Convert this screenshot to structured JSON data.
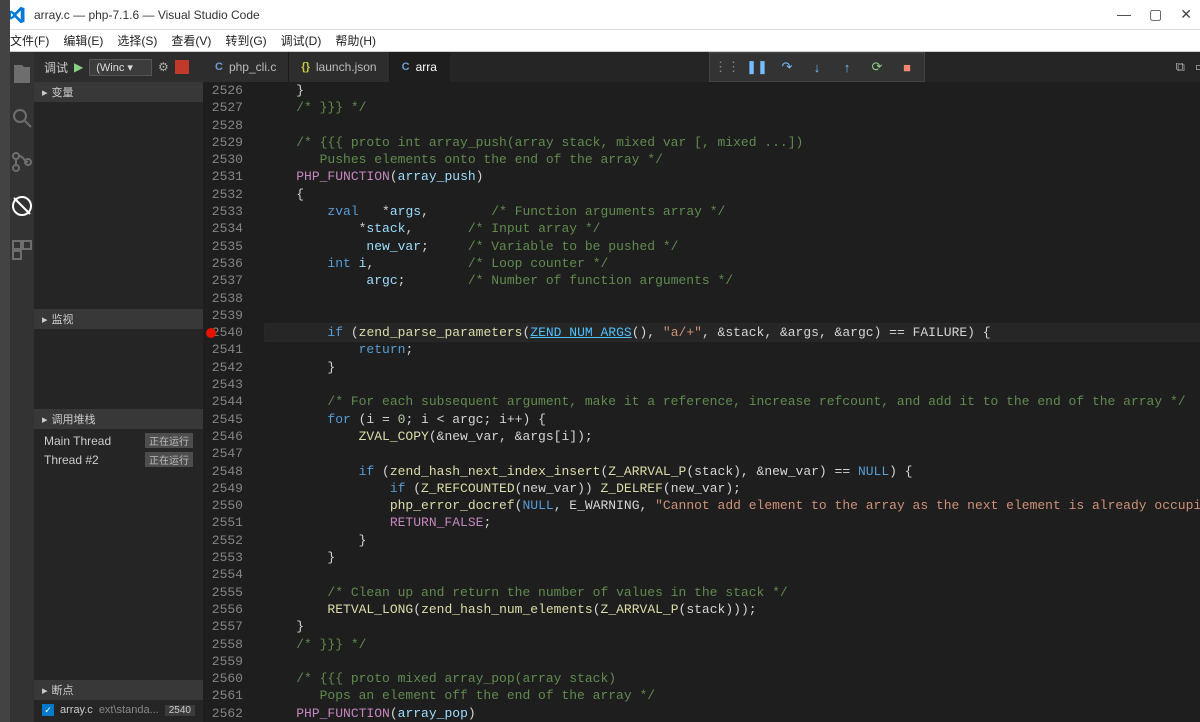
{
  "window": {
    "title": "array.c — php-7.1.6 — Visual Studio Code"
  },
  "menubar": [
    "文件(F)",
    "编辑(E)",
    "选择(S)",
    "查看(V)",
    "转到(G)",
    "调试(D)",
    "帮助(H)"
  ],
  "debugTop": {
    "label": "调试",
    "config": "(Winc"
  },
  "sidebar": {
    "variables": {
      "title": "变量"
    },
    "watch": {
      "title": "监视"
    },
    "callstack": {
      "title": "调用堆栈",
      "threads": [
        {
          "name": "Main Thread",
          "state": "正在运行"
        },
        {
          "name": "Thread #2",
          "state": "正在运行"
        }
      ]
    },
    "breakpoints": {
      "title": "断点",
      "items": [
        {
          "label": "array.c",
          "detail": "ext\\standa...",
          "line": "2540"
        }
      ]
    }
  },
  "tabs": [
    {
      "iconLetter": "C",
      "iconClass": "c-c",
      "label": "php_cli.c",
      "active": false
    },
    {
      "iconLetter": "{}",
      "iconClass": "c-j",
      "label": "launch.json",
      "active": false
    },
    {
      "iconLetter": "C",
      "iconClass": "c-c",
      "label": "arra",
      "active": true
    }
  ],
  "editor": {
    "startLine": 2526,
    "breakpointLine": 2540,
    "currentLine": 2540,
    "lines": [
      [
        [
          "    ",
          ""
        ],
        [
          "}",
          ""
        ]
      ],
      [
        [
          "    ",
          ""
        ],
        [
          "/* }}} */",
          "tok-comment"
        ]
      ],
      [
        [
          "",
          ""
        ]
      ],
      [
        [
          "    ",
          ""
        ],
        [
          "/* {{{ proto int array_push(array stack, mixed var [, mixed ...])",
          "tok-comment"
        ]
      ],
      [
        [
          "       ",
          ""
        ],
        [
          "Pushes elements onto the end of the array */",
          "tok-comment"
        ]
      ],
      [
        [
          "    ",
          ""
        ],
        [
          "PHP_FUNCTION",
          "tok-macro"
        ],
        [
          "(",
          ""
        ],
        [
          "array_push",
          "tok-ident"
        ],
        [
          ")",
          ""
        ]
      ],
      [
        [
          "    ",
          ""
        ],
        [
          "{",
          ""
        ]
      ],
      [
        [
          "        ",
          ""
        ],
        [
          "zval",
          "tok-type"
        ],
        [
          "   *",
          ""
        ],
        [
          "args",
          "tok-ident"
        ],
        [
          ",        ",
          ""
        ],
        [
          "/* Function arguments array */",
          "tok-comment"
        ]
      ],
      [
        [
          "            *",
          ""
        ],
        [
          "stack",
          "tok-ident"
        ],
        [
          ",       ",
          ""
        ],
        [
          "/* Input array */",
          "tok-comment"
        ]
      ],
      [
        [
          "             ",
          ""
        ],
        [
          "new_var",
          "tok-ident"
        ],
        [
          ";     ",
          ""
        ],
        [
          "/* Variable to be pushed */",
          "tok-comment"
        ]
      ],
      [
        [
          "        ",
          ""
        ],
        [
          "int",
          "tok-type"
        ],
        [
          " ",
          ""
        ],
        [
          "i",
          "tok-ident"
        ],
        [
          ",            ",
          ""
        ],
        [
          "/* Loop counter */",
          "tok-comment"
        ]
      ],
      [
        [
          "             ",
          ""
        ],
        [
          "argc",
          "tok-ident"
        ],
        [
          ";        ",
          ""
        ],
        [
          "/* Number of function arguments */",
          "tok-comment"
        ]
      ],
      [
        [
          "",
          ""
        ]
      ],
      [
        [
          "",
          ""
        ]
      ],
      [
        [
          "        ",
          ""
        ],
        [
          "if",
          "tok-keyword"
        ],
        [
          " (",
          ""
        ],
        [
          "zend_parse_parameters",
          "tok-func"
        ],
        [
          "(",
          ""
        ],
        [
          "ZEND_NUM_ARGS",
          "tok-link"
        ],
        [
          "(), ",
          ""
        ],
        [
          "\"a/+\"",
          "tok-str"
        ],
        [
          ", &stack, &args, &argc) == FAILURE) {",
          ""
        ]
      ],
      [
        [
          "            ",
          ""
        ],
        [
          "return",
          "tok-keyword"
        ],
        [
          ";",
          ""
        ]
      ],
      [
        [
          "        }",
          ""
        ]
      ],
      [
        [
          "",
          ""
        ]
      ],
      [
        [
          "        ",
          ""
        ],
        [
          "/* For each subsequent argument, make it a reference, increase refcount, and add it to the end of the array */",
          "tok-comment"
        ]
      ],
      [
        [
          "        ",
          ""
        ],
        [
          "for",
          "tok-keyword"
        ],
        [
          " (i = ",
          ""
        ],
        [
          "0",
          "tok-num"
        ],
        [
          "; i < argc; i++) {",
          ""
        ]
      ],
      [
        [
          "            ",
          ""
        ],
        [
          "ZVAL_COPY",
          "tok-func"
        ],
        [
          "(&new_var, &args[i]);",
          ""
        ]
      ],
      [
        [
          "",
          ""
        ]
      ],
      [
        [
          "            ",
          ""
        ],
        [
          "if",
          "tok-keyword"
        ],
        [
          " (",
          ""
        ],
        [
          "zend_hash_next_index_insert",
          "tok-func"
        ],
        [
          "(",
          ""
        ],
        [
          "Z_ARRVAL_P",
          "tok-func"
        ],
        [
          "(stack), &new_var) == ",
          ""
        ],
        [
          "NULL",
          "tok-keyword"
        ],
        [
          ") {",
          ""
        ]
      ],
      [
        [
          "                ",
          ""
        ],
        [
          "if",
          "tok-keyword"
        ],
        [
          " (",
          ""
        ],
        [
          "Z_REFCOUNTED",
          "tok-func"
        ],
        [
          "(new_var)) ",
          ""
        ],
        [
          "Z_DELREF",
          "tok-func"
        ],
        [
          "(new_var);",
          ""
        ]
      ],
      [
        [
          "                ",
          ""
        ],
        [
          "php_error_docref",
          "tok-func"
        ],
        [
          "(",
          ""
        ],
        [
          "NULL",
          "tok-keyword"
        ],
        [
          ", E_WARNING, ",
          ""
        ],
        [
          "\"Cannot add element to the array as the next element is already occupied\"",
          "tok-str"
        ],
        [
          ");",
          ""
        ]
      ],
      [
        [
          "                ",
          ""
        ],
        [
          "RETURN_FALSE",
          "tok-macro"
        ],
        [
          ";",
          ""
        ]
      ],
      [
        [
          "            }",
          ""
        ]
      ],
      [
        [
          "        }",
          ""
        ]
      ],
      [
        [
          "",
          ""
        ]
      ],
      [
        [
          "        ",
          ""
        ],
        [
          "/* Clean up and return the number of values in the stack */",
          "tok-comment"
        ]
      ],
      [
        [
          "        ",
          ""
        ],
        [
          "RETVAL_LONG",
          "tok-func"
        ],
        [
          "(",
          ""
        ],
        [
          "zend_hash_num_elements",
          "tok-func"
        ],
        [
          "(",
          ""
        ],
        [
          "Z_ARRVAL_P",
          "tok-func"
        ],
        [
          "(stack)));",
          ""
        ]
      ],
      [
        [
          "    }",
          ""
        ]
      ],
      [
        [
          "    ",
          ""
        ],
        [
          "/* }}} */",
          "tok-comment"
        ]
      ],
      [
        [
          "",
          ""
        ]
      ],
      [
        [
          "    ",
          ""
        ],
        [
          "/* {{{ proto mixed array_pop(array stack)",
          "tok-comment"
        ]
      ],
      [
        [
          "       ",
          ""
        ],
        [
          "Pops an element off the end of the array */",
          "tok-comment"
        ]
      ],
      [
        [
          "    ",
          ""
        ],
        [
          "PHP_FUNCTION",
          "tok-macro"
        ],
        [
          "(",
          ""
        ],
        [
          "array_pop",
          "tok-ident"
        ],
        [
          ")",
          ""
        ]
      ]
    ]
  }
}
